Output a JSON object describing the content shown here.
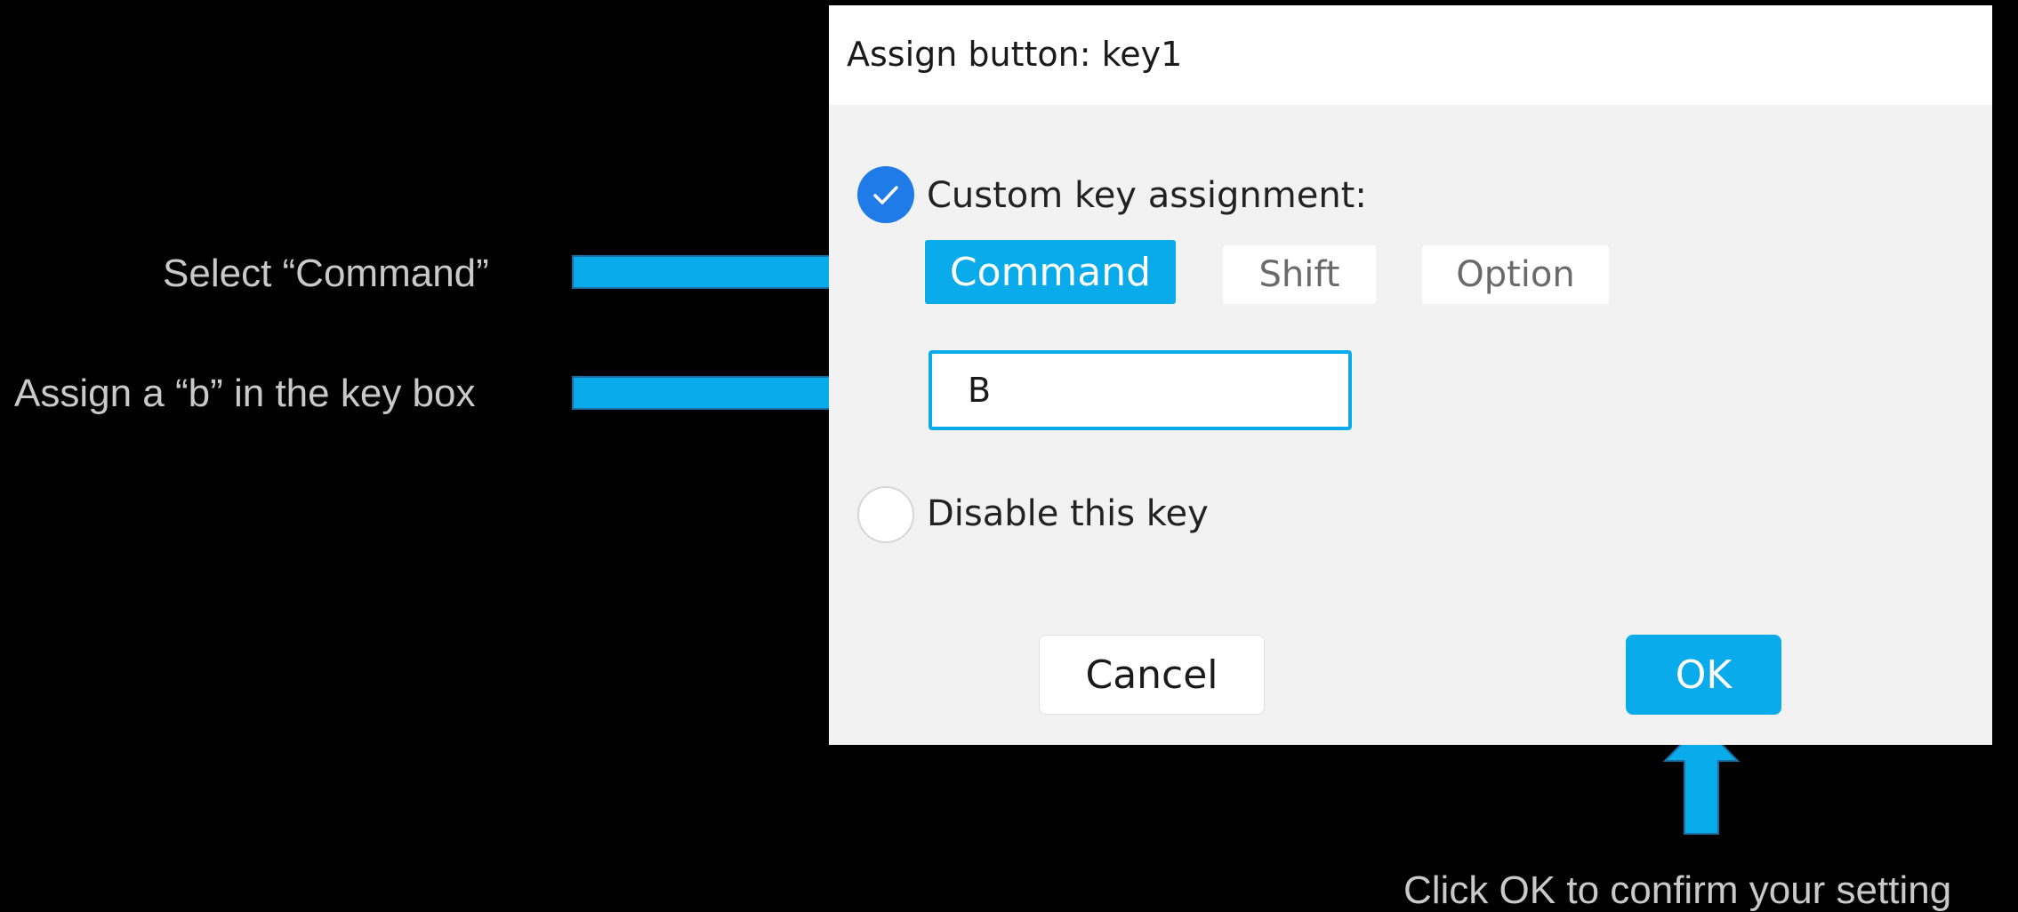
{
  "annotations": {
    "select_command": "Select “Command”",
    "assign_b": "Assign a “b” in the key box",
    "click_ok": "Click OK to confirm your setting"
  },
  "dialog": {
    "title": "Assign button: key1",
    "custom_assignment": {
      "label": "Custom key assignment:",
      "checked": true,
      "icon": "check-icon"
    },
    "modifiers": [
      {
        "label": "Command",
        "selected": true
      },
      {
        "label": "Shift",
        "selected": false
      },
      {
        "label": "Option",
        "selected": false
      }
    ],
    "key_box": {
      "value": "B"
    },
    "disable_key": {
      "label": "Disable this key",
      "checked": false
    },
    "cancel_label": "Cancel",
    "ok_label": "OK"
  },
  "colors": {
    "accent": "#0aabeb",
    "check_blue": "#1e7be8",
    "annotation_text": "#c9c9c9",
    "background": "#000000"
  }
}
